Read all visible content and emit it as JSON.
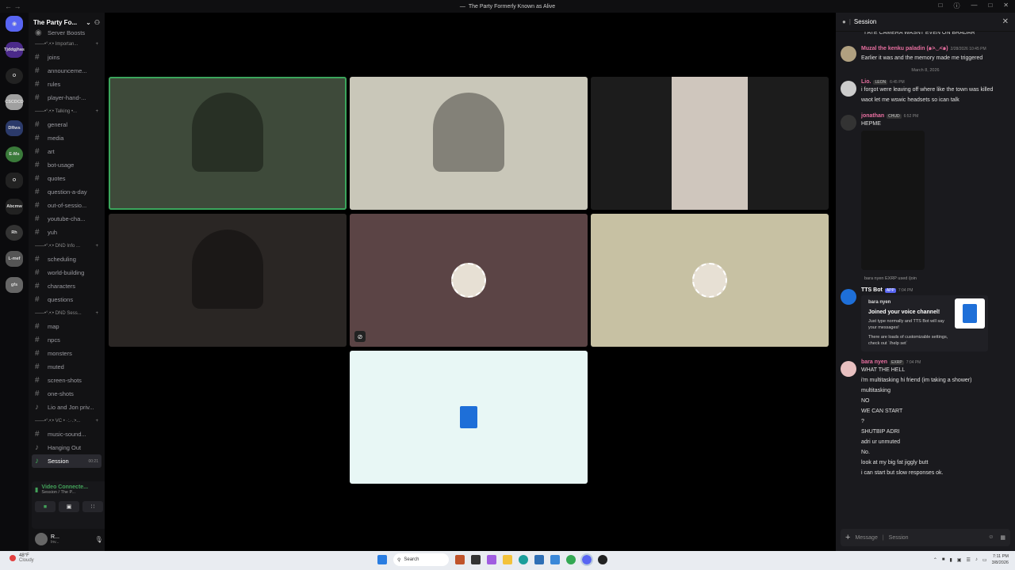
{
  "window": {
    "title": "The Party Formerly Known as Alive"
  },
  "servers": [
    "Tjddgjhas",
    "O",
    "CSCDCD",
    "DRws",
    "E-Ms",
    "O",
    "Abcmw",
    "Rh",
    "L-mef",
    "gfs"
  ],
  "server_name": "The Party Fo...",
  "top_item": "Server Boosts",
  "sidebar": [
    {
      "type": "cat",
      "label": "——•°.•:• Importan..."
    },
    {
      "type": "text",
      "label": "joins"
    },
    {
      "type": "text",
      "label": "announceme..."
    },
    {
      "type": "text",
      "label": "rules"
    },
    {
      "type": "text",
      "label": "player-hand-..."
    },
    {
      "type": "cat",
      "label": "——•°.•:• Talking •..."
    },
    {
      "type": "text",
      "label": "general"
    },
    {
      "type": "text",
      "label": "media"
    },
    {
      "type": "text",
      "label": "art"
    },
    {
      "type": "text",
      "label": "bot-usage"
    },
    {
      "type": "text",
      "label": "quotes"
    },
    {
      "type": "text",
      "label": "question-a-day"
    },
    {
      "type": "text",
      "label": "out-of-sessio..."
    },
    {
      "type": "text",
      "label": "youtube-cha..."
    },
    {
      "type": "text",
      "label": "yuh"
    },
    {
      "type": "cat",
      "label": "——•°.•:• DND Info ..."
    },
    {
      "type": "text",
      "label": "scheduling"
    },
    {
      "type": "text",
      "label": "world-building"
    },
    {
      "type": "text",
      "label": "characters"
    },
    {
      "type": "text",
      "label": "questions"
    },
    {
      "type": "cat",
      "label": "——•°.•:• DND Sess..."
    },
    {
      "type": "text",
      "label": "map"
    },
    {
      "type": "text",
      "label": "npcs"
    },
    {
      "type": "text",
      "label": "monsters"
    },
    {
      "type": "text",
      "label": "muted"
    },
    {
      "type": "text",
      "label": "screen-shots"
    },
    {
      "type": "text",
      "label": "one-shots"
    },
    {
      "type": "voice",
      "label": "Lio and Jon priv..."
    },
    {
      "type": "cat",
      "label": "——•°.•:• VC • ·:.·.:•..."
    },
    {
      "type": "text",
      "label": "music-sound..."
    },
    {
      "type": "voice",
      "label": "Hanging Out"
    },
    {
      "type": "voice",
      "label": "Session",
      "active": true,
      "timer": "00:21"
    }
  ],
  "voice_panel": {
    "status": "Video Connecte...",
    "channel": "Session / The P..."
  },
  "user_panel": {
    "name": "R...",
    "status": "Inv..."
  },
  "tiles": [
    {
      "kind": "cam",
      "bg": "#3e4a3a",
      "speaking": true
    },
    {
      "kind": "cam",
      "bg": "#c9c7b9"
    },
    {
      "kind": "cam",
      "bg": "#2b2b2b"
    },
    {
      "kind": "cam",
      "bg": "#2a2624"
    },
    {
      "kind": "avatar",
      "bg": "#5b4445",
      "muted": true
    },
    {
      "kind": "avatar",
      "bg": "#c7c1a3"
    },
    {
      "kind": "bot",
      "bg": "#e8f7f5"
    }
  ],
  "chat": {
    "title": "Session",
    "input_placeholder": "Message",
    "input_channel": "Session",
    "top_cut": "I ATE CAMERA WASNT EVEN ON BRADAR",
    "messages": [
      {
        "author": "Muzal the kenku paladin (๑>◡<๑)",
        "color": "#e86fa0",
        "time": "2/28/2026 10:45 PM",
        "lines": [
          "Earlier it was and the memory made me triggered"
        ],
        "av": "#b0a080"
      },
      {
        "divider": "March 8, 2026"
      },
      {
        "author": "Lio.",
        "color": "#e86fa0",
        "tag": "LEON",
        "time": "6:45 PM",
        "lines": [
          "i forgot were leaving off where like the town was killed",
          "waot let me wswic headsets so ican talk"
        ],
        "av": "#ccc"
      },
      {
        "author": "jonathan",
        "color": "#e86fa0",
        "tag": "CHUD",
        "time": "6:52 PM",
        "lines": [
          "HEPME"
        ],
        "image": true,
        "av": "#333"
      },
      {
        "reply": "bara nyen EXRP used /join"
      },
      {
        "author": "TTS Bot",
        "color": "#ffffff",
        "tag": "APP",
        "time": "7:04 PM",
        "embed": {
          "author": "bara nyen",
          "title": "Joined your voice channel!",
          "text": "Just type normally and TTS Bot will say your messages!",
          "text2": "There are loads of customizable settings, check out `/help set`"
        },
        "av": "#1e6fd8"
      },
      {
        "author": "bara nyen",
        "color": "#e86fa0",
        "tag": "EXRP",
        "time": "7:04 PM",
        "lines": [
          "WHAT THE HELL",
          "i'm multitasking hi friend (im taking a shower)",
          "multitasking",
          "NO",
          "WE CAN START",
          "?",
          "SHUTBIP ADRI",
          "adri ur unmuted",
          "No.",
          "look at my big fat jiggly butt",
          "i can start but slow responses ok."
        ],
        "av": "#e8c0c0"
      }
    ]
  },
  "taskbar": {
    "temp": "48°F",
    "weather": "Cloudy",
    "search": "Search",
    "time": "7:11 PM",
    "date": "3/8/2026"
  }
}
